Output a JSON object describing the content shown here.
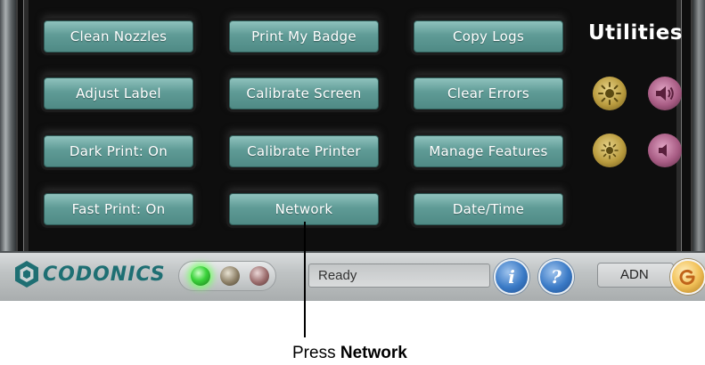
{
  "screen": {
    "title": "Utilities",
    "buttons": [
      [
        "Clean Nozzles",
        "Print My Badge",
        "Copy Logs"
      ],
      [
        "Adjust Label",
        "Calibrate Screen",
        "Clear Errors"
      ],
      [
        "Dark Print: On",
        "Calibrate Printer",
        "Manage Features"
      ],
      [
        "Fast Print: On",
        "Network",
        "Date/Time"
      ]
    ],
    "controls": {
      "brightness_up_icon": "sun-icon",
      "volume_up_icon": "speaker-loud-icon",
      "brightness_down_icon": "sun-small-icon",
      "volume_down_icon": "speaker-soft-icon"
    }
  },
  "status_bar": {
    "logo": "CODONICS",
    "status_text": "Ready",
    "info_label": "i",
    "help_label": "?",
    "user": "ADN",
    "led_colors": {
      "green": "#3bd33b",
      "amber": "#8c7f66",
      "red": "#9a6b6b"
    }
  },
  "caption": {
    "prefix": "Press ",
    "emphasis": "Network"
  },
  "colors": {
    "button": "#5f9b96",
    "screen": "#0e0e0e"
  }
}
